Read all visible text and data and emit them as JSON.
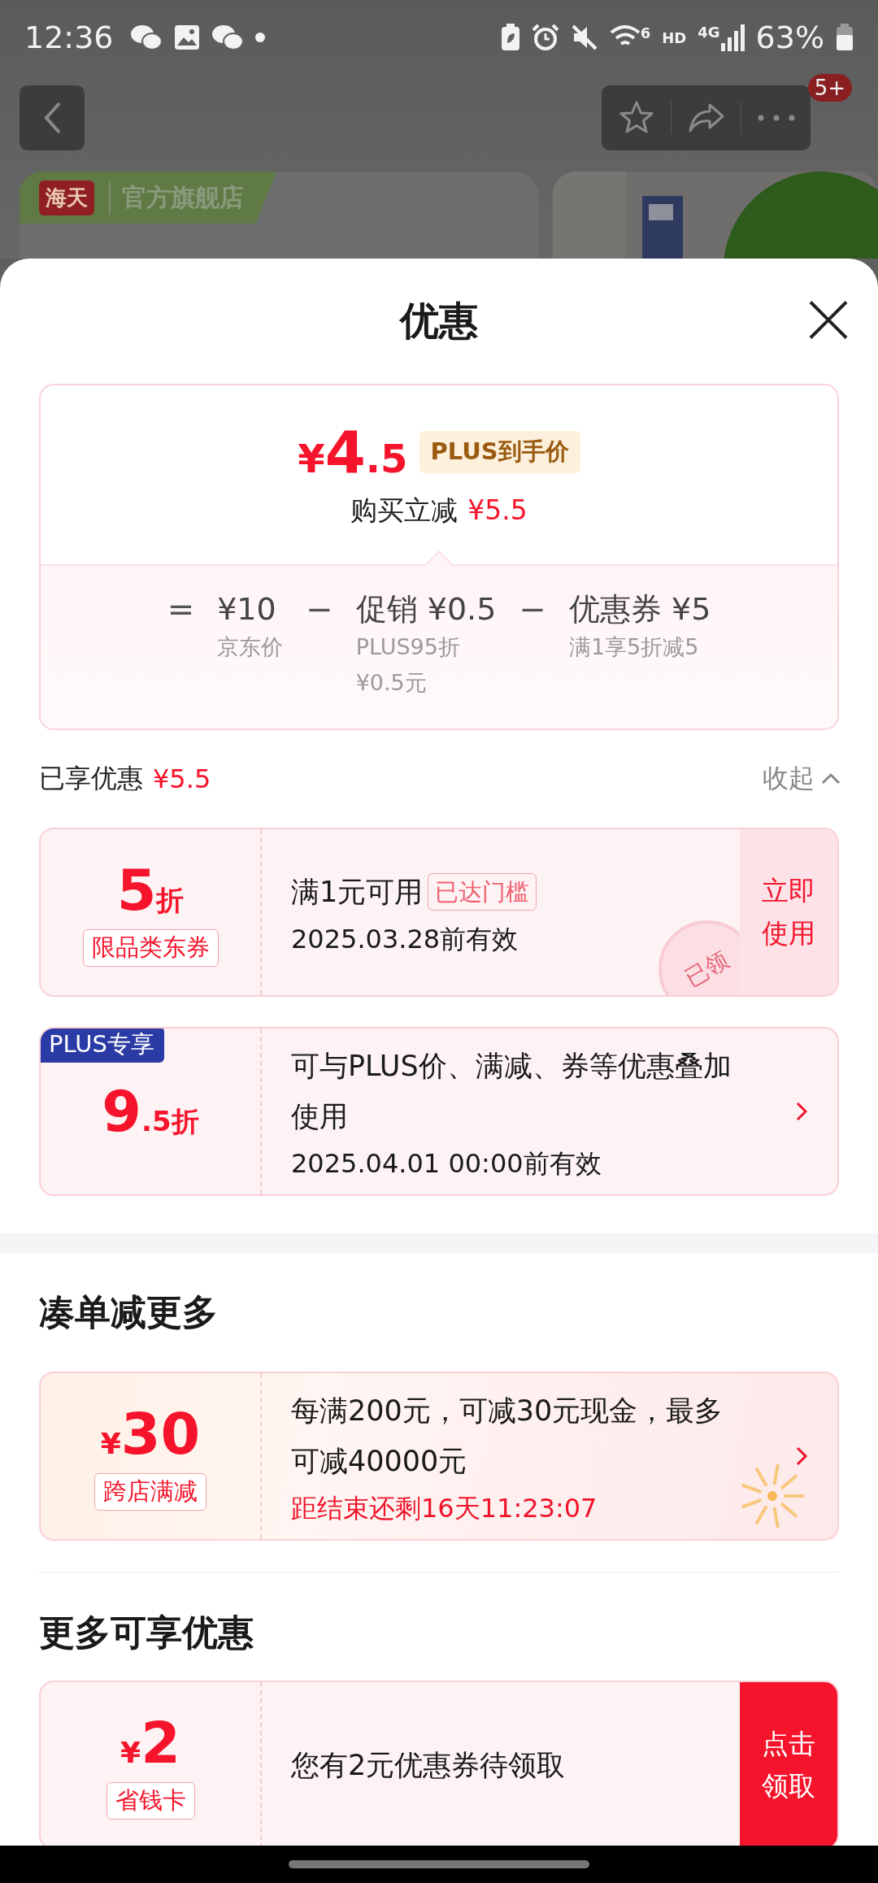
{
  "status_bar": {
    "time": "12:36",
    "wifi_label": "6",
    "hd": "HD",
    "network": "4G",
    "battery": "63%"
  },
  "nav": {
    "badge": "5+"
  },
  "store_banner": {
    "logo": "海天",
    "name": "官方旗舰店"
  },
  "sheet": {
    "title": "优惠"
  },
  "price_card": {
    "currency": "¥",
    "price_int": "4",
    "price_dec": ".5",
    "tag": "PLUS到手价",
    "saving_label": "购买立减",
    "saving_value": "¥5.5",
    "breakdown": [
      {
        "op": "=",
        "value": "¥10",
        "notes": [
          "京东价"
        ]
      },
      {
        "op": "−",
        "label": "促销",
        "value": "¥0.5",
        "notes": [
          "PLUS95折",
          "¥0.5元"
        ]
      },
      {
        "op": "−",
        "label": "优惠券",
        "value": "¥5",
        "notes": [
          "满1享5折减5"
        ]
      }
    ]
  },
  "enjoyed": {
    "label": "已享优惠",
    "value": "¥5.5",
    "toggle": "收起",
    "expanded": true
  },
  "coupons": [
    {
      "kind": "standard",
      "main": "5",
      "suffix": "折",
      "tag": "限品类东券",
      "title": "满1元可用",
      "badge": "已达门槛",
      "subtitle": "2025.03.28前有效",
      "claimed": true,
      "stamp": "已领",
      "action": {
        "kind": "pale",
        "label": "立即使用"
      }
    },
    {
      "kind": "standard",
      "corner_tag": "PLUS专享",
      "main": "9",
      "suffix": ".5折",
      "title": "可与PLUS价、满减、券等优惠叠加使用",
      "subtitle": "2025.04.01 00:00前有效",
      "claimed": false,
      "action": {
        "kind": "chevron"
      }
    }
  ],
  "sections": [
    {
      "title": "凑单减更多",
      "coupons": [
        {
          "kind": "festive",
          "prefix": "¥",
          "main": "30",
          "tag": "跨店满减",
          "title": "每满200元，可减30元现金，最多可减40000元",
          "countdown": "距结束还剩16天11:23:07",
          "claimed": false,
          "action": {
            "kind": "chevron"
          }
        }
      ]
    },
    {
      "title": "更多可享优惠",
      "coupons": [
        {
          "kind": "standard",
          "prefix": "¥",
          "main": "2",
          "tag": "省钱卡",
          "title": "您有2元优惠券待领取",
          "claimed": false,
          "action": {
            "kind": "solid",
            "label": "点击领取"
          }
        }
      ]
    }
  ]
}
